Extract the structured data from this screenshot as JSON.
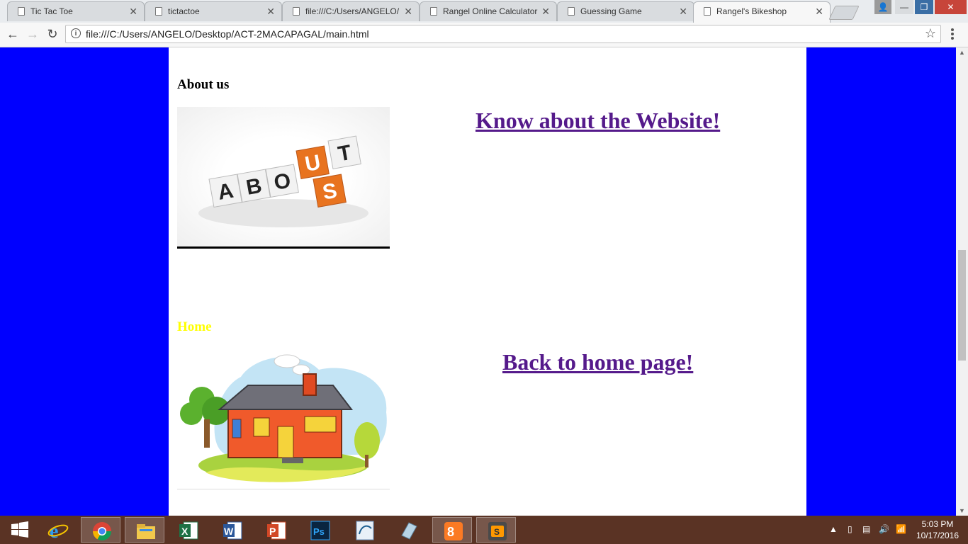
{
  "browser": {
    "tabs": [
      {
        "title": "Tic Tac Toe"
      },
      {
        "title": "tictactoe"
      },
      {
        "title": "file:///C:/Users/ANGELO/"
      },
      {
        "title": "Rangel Online Calculator"
      },
      {
        "title": "Guessing Game"
      },
      {
        "title": "Rangel's Bikeshop"
      }
    ],
    "active_tab": 5,
    "url": "file:///C:/Users/ANGELO/Desktop/ACT-2MACAPAGAL/main.html"
  },
  "page": {
    "about": {
      "heading": "About us",
      "image_letters": [
        "A",
        "B",
        "O",
        "U",
        "T",
        "S"
      ],
      "link": "Know about the Website!"
    },
    "home": {
      "heading": "Home",
      "link": "Back to home page!"
    },
    "colors": {
      "background": "#0000ff",
      "content": "#ffffff",
      "link": "#551a8b",
      "home_heading": "#ffff00",
      "about_orange": "#e8731f"
    }
  },
  "taskbar": {
    "apps": [
      "start-icon",
      "internet-explorer-icon",
      "chrome-icon",
      "file-explorer-icon",
      "excel-icon",
      "word-icon",
      "powerpoint-icon",
      "photoshop-icon",
      "mysql-installer-icon",
      "app-icon",
      "xampp-icon",
      "sublime-text-icon"
    ],
    "time": "5:03 PM",
    "date": "10/17/2016"
  }
}
